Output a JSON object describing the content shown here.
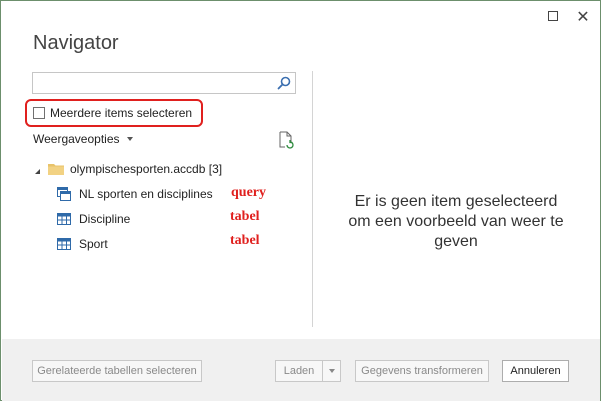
{
  "window": {
    "title": "Navigator",
    "maximize_icon": "maximize-icon",
    "close_icon": "close-icon",
    "close_glyph": "✕"
  },
  "search": {
    "value": "",
    "placeholder": "",
    "icon": "search-icon"
  },
  "multi_select": {
    "label": "Meerdere items selecteren",
    "checked": false
  },
  "view_options": {
    "label": "Weergaveopties"
  },
  "tree": {
    "root": {
      "label": "olympischesporten.accdb [3]",
      "icon": "folder-icon",
      "expanded": true
    },
    "items": [
      {
        "label": "NL sporten en disciplines",
        "icon": "query-icon",
        "annotation": "query"
      },
      {
        "label": "Discipline",
        "icon": "table-icon",
        "annotation": "tabel"
      },
      {
        "label": "Sport",
        "icon": "table-icon",
        "annotation": "tabel"
      }
    ]
  },
  "preview": {
    "line1": "Er is geen item geselecteerd",
    "line2": "om een voorbeeld van weer te",
    "line3": "geven"
  },
  "footer": {
    "related_tables_label": "Gerelateerde tabellen selecteren",
    "load_label": "Laden",
    "transform_label": "Gegevens transformeren",
    "cancel_label": "Annuleren"
  },
  "colors": {
    "annotation_red": "#e0201e",
    "folder_yellow": "#e8c36a",
    "icon_blue": "#2f6aa9",
    "footer_bg": "#f0f0f0"
  }
}
